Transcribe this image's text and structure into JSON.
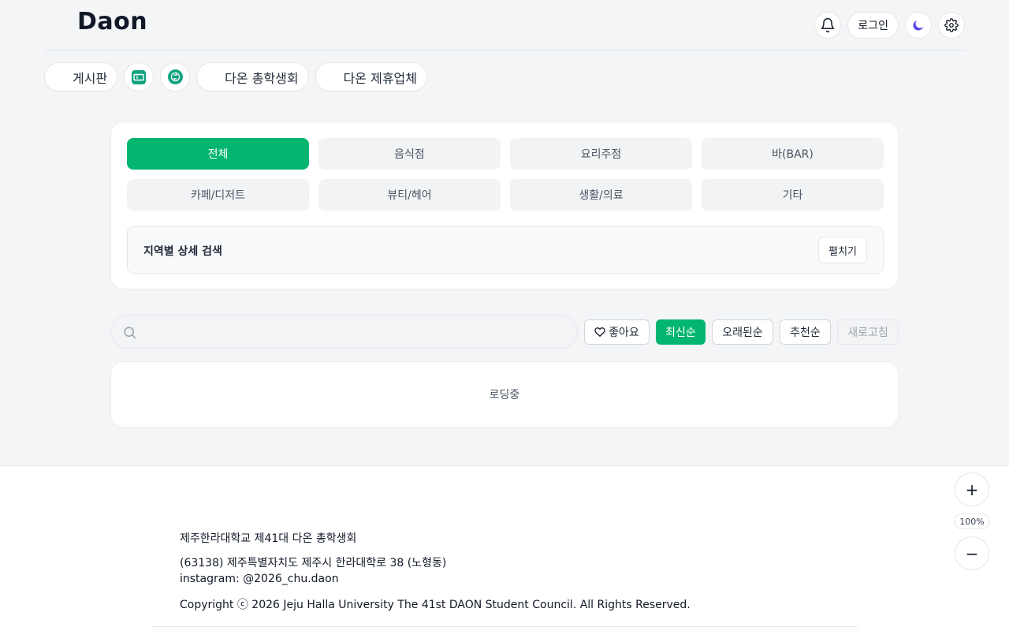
{
  "header": {
    "brand": "Daon",
    "login_label": "로그인",
    "icons": [
      "bell-icon",
      "moon-icon",
      "gear-icon"
    ],
    "moon_color": "#4f46e5"
  },
  "nav": {
    "board_label": "게시판",
    "council_label": "다온 총학생회",
    "partners_label": "다온 제휴업체",
    "icons": [
      "ticket-icon",
      "swap-icon"
    ],
    "icon_color": "#10a37f"
  },
  "categories": {
    "items": [
      "전체",
      "음식점",
      "요리주점",
      "바(BAR)",
      "카페/디저트",
      "뷰티/헤어",
      "생활/의료",
      "기타"
    ],
    "active": "전체",
    "active_color": "#03b670"
  },
  "region": {
    "title": "지역별 상세 검색",
    "toggle_label": "펼치기"
  },
  "search": {
    "placeholder": ""
  },
  "sort": {
    "like_label": "좋아요",
    "newest_label": "최신순",
    "oldest_label": "오래된순",
    "recommended_label": "추천순",
    "refresh_label": "새로고침",
    "active": "최신순"
  },
  "list": {
    "loading_text": "로딩중"
  },
  "footer": {
    "org": "제주한라대학교 제41대 다온 총학생회",
    "address": "(63138) 제주특별자치도 제주시 한라대학로 38 (노형동)",
    "instagram": "instagram: @2026_chu.daon",
    "copyright": "Copyright ⓒ 2026 Jeju Halla University The 41st DAON Student Council. All Rights Reserved."
  },
  "zoom": {
    "level": "100%",
    "plus": "+",
    "minus": "−"
  }
}
